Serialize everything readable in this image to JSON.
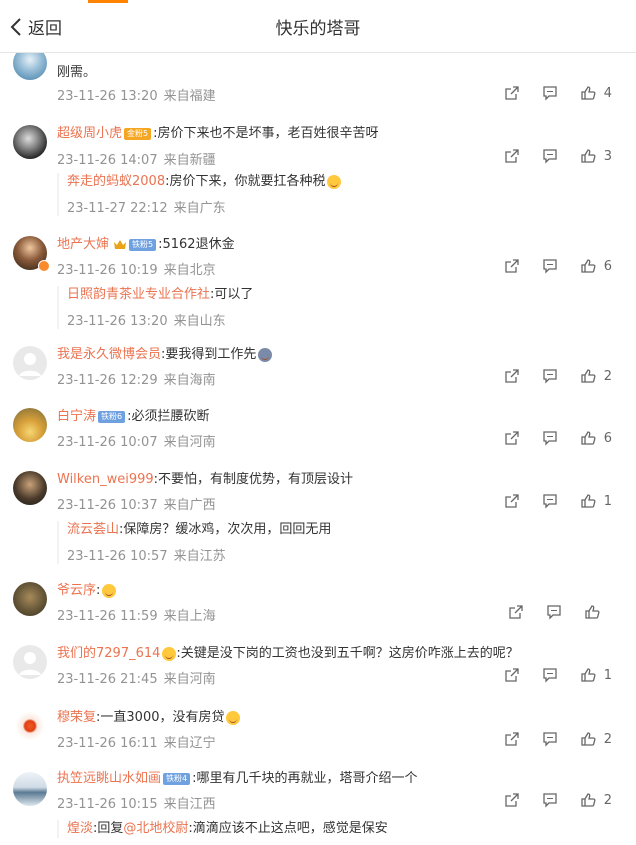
{
  "header": {
    "back_label": "返回",
    "title": "快乐的塔哥"
  },
  "comments": [
    {
      "name": "…",
      "text": "",
      "meta_time": "",
      "meta_src": "",
      "partial_lines": [
        "「 …  刚需。"
      ],
      "time": "23-11-26 13:20",
      "src": "来自福建",
      "likes": "4"
    },
    {
      "name": "超级周小虎",
      "text": ":房价下来也不是坏事，老百姓很辛苦呀",
      "time": "23-11-26 14:07",
      "src": "来自新疆",
      "likes": "3",
      "reply": {
        "name": "奔走的蚂蚁2008",
        "text": ":房价下来，你就要扛各种税",
        "time": "23-11-27 22:12",
        "src": "来自广东"
      }
    },
    {
      "name": "地产大婶",
      "text": ":5162退休金",
      "time": "23-11-26 10:19",
      "src": "来自北京",
      "likes": "6",
      "reply": {
        "name": "日照韵青茶业专业合作社",
        "text": ":可以了",
        "time": "23-11-26 13:20",
        "src": "来自山东"
      }
    },
    {
      "name": "我是永久微博会员",
      "text": ":要我得到工作先",
      "time": "23-11-26 12:29",
      "src": "来自海南",
      "likes": "2"
    },
    {
      "name": "白宁涛",
      "text": ":必须拦腰砍断",
      "time": "23-11-26 10:07",
      "src": "来自河南",
      "likes": "6"
    },
    {
      "name": "Wilken_wei999",
      "text": ":不要怕，有制度优势，有顶层设计",
      "time": "23-11-26 10:37",
      "src": "来自广西",
      "likes": "1",
      "reply": {
        "name": "流云荟山",
        "text": ":保障房？缓冰鸡，次次用，回回无用",
        "time": "23-11-26 10:57",
        "src": "来自江苏"
      }
    },
    {
      "name": "爷云序",
      "text": ":",
      "time": "23-11-26 11:59",
      "src": "来自上海",
      "likes": ""
    },
    {
      "name": "我们的7297_614",
      "text": ":关键是没下岗的工资也没到五千啊？这房价咋涨上去的呢？",
      "time": "23-11-26 21:45",
      "src": "来自河南",
      "likes": "1"
    },
    {
      "name": "穆荣复",
      "text": ":一直3000，没有房贷",
      "time": "23-11-26 16:11",
      "src": "来自辽宁",
      "likes": "2"
    },
    {
      "name": "执笠远眺山水如画",
      "text": ":哪里有几千块的再就业，塔哥介绍一个",
      "time": "23-11-26 10:15",
      "src": "来自江西",
      "likes": "2",
      "reply": {
        "name": "煌淡",
        "text": ":回复",
        "mention": "@北地校尉",
        "text2": ":滴滴应该不止这点吧，感觉是保安",
        "time": "",
        "src": ""
      }
    }
  ],
  "badges": {
    "gold": "金粉5",
    "blue5": "铁粉5",
    "blue6": "铁粉6",
    "blue4": "铁粉4"
  },
  "first_line_tail": "刚需。"
}
